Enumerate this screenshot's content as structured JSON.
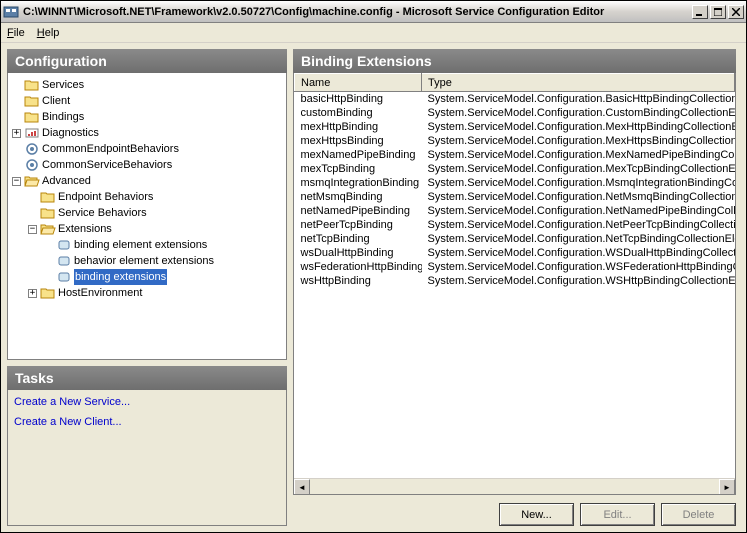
{
  "window": {
    "title": "C:\\WINNT\\Microsoft.NET\\Framework\\v2.0.50727\\Config\\machine.config - Microsoft Service Configuration Editor"
  },
  "menu": {
    "file": "File",
    "help": "Help"
  },
  "panels": {
    "config": "Configuration",
    "tasks": "Tasks",
    "binding_ext": "Binding Extensions"
  },
  "tree": {
    "services": "Services",
    "client": "Client",
    "bindings": "Bindings",
    "diagnostics": "Diagnostics",
    "common_endpoint": "CommonEndpointBehaviors",
    "common_service": "CommonServiceBehaviors",
    "advanced": "Advanced",
    "endpoint_behaviors": "Endpoint Behaviors",
    "service_behaviors": "Service Behaviors",
    "extensions": "Extensions",
    "binding_element_ext": "binding element extensions",
    "behavior_element_ext": "behavior element extensions",
    "binding_ext": "binding extensions",
    "host_env": "HostEnvironment"
  },
  "tasks": {
    "new_service": "Create a New Service...",
    "new_client": "Create a New Client..."
  },
  "table": {
    "col_name": "Name",
    "col_type": "Type",
    "rows": [
      {
        "name": "basicHttpBinding",
        "type": "System.ServiceModel.Configuration.BasicHttpBindingCollectionElem"
      },
      {
        "name": "customBinding",
        "type": "System.ServiceModel.Configuration.CustomBindingCollectionElemer"
      },
      {
        "name": "mexHttpBinding",
        "type": "System.ServiceModel.Configuration.MexHttpBindingCollectionEleme"
      },
      {
        "name": "mexHttpsBinding",
        "type": "System.ServiceModel.Configuration.MexHttpsBindingCollectionElem"
      },
      {
        "name": "mexNamedPipeBinding",
        "type": "System.ServiceModel.Configuration.MexNamedPipeBindingCollection"
      },
      {
        "name": "mexTcpBinding",
        "type": "System.ServiceModel.Configuration.MexTcpBindingCollectionEleme"
      },
      {
        "name": "msmqIntegrationBinding",
        "type": "System.ServiceModel.Configuration.MsmqIntegrationBindingCollecti"
      },
      {
        "name": "netMsmqBinding",
        "type": "System.ServiceModel.Configuration.NetMsmqBindingCollectionElem"
      },
      {
        "name": "netNamedPipeBinding",
        "type": "System.ServiceModel.Configuration.NetNamedPipeBindingCollectionE"
      },
      {
        "name": "netPeerTcpBinding",
        "type": "System.ServiceModel.Configuration.NetPeerTcpBindingCollectionEle"
      },
      {
        "name": "netTcpBinding",
        "type": "System.ServiceModel.Configuration.NetTcpBindingCollectionElemer"
      },
      {
        "name": "wsDualHttpBinding",
        "type": "System.ServiceModel.Configuration.WSDualHttpBindingCollectionEl"
      },
      {
        "name": "wsFederationHttpBinding",
        "type": "System.ServiceModel.Configuration.WSFederationHttpBindingCollec"
      },
      {
        "name": "wsHttpBinding",
        "type": "System.ServiceModel.Configuration.WSHttpBindingCollectionElemer"
      }
    ]
  },
  "buttons": {
    "new": "New...",
    "edit": "Edit...",
    "delete": "Delete"
  }
}
